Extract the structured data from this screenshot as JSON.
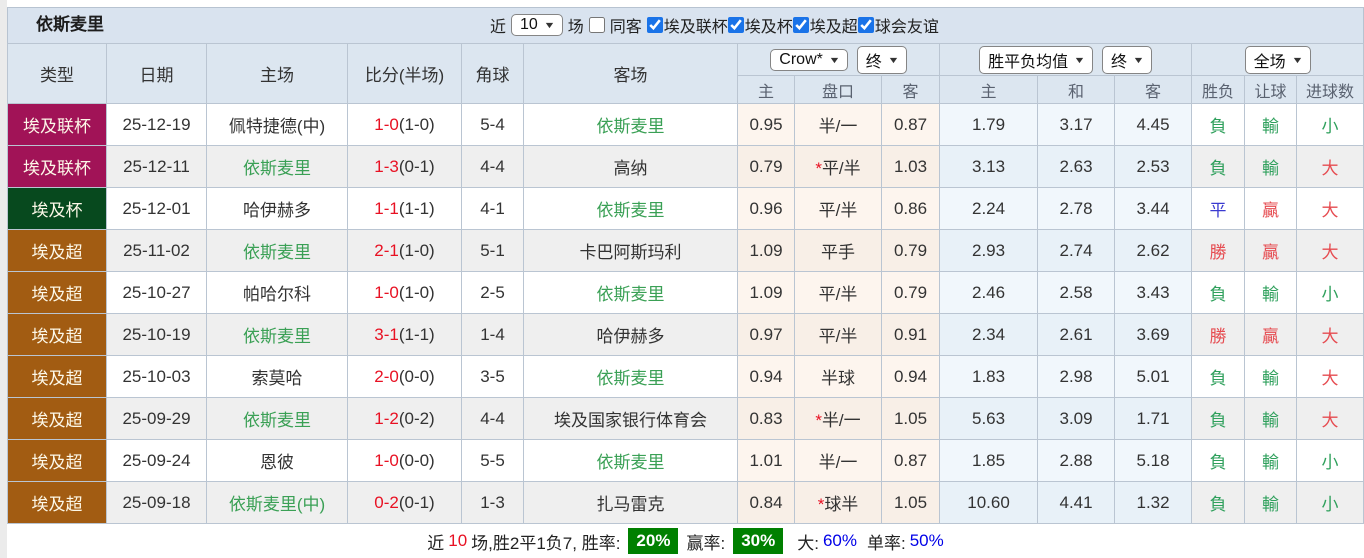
{
  "colors": {
    "league": {
      "埃及联杯": "#a11357",
      "埃及杯": "#07491e",
      "埃及超": "#a25c12"
    },
    "outcome": {
      "g": "#2fa05c",
      "r": "#e64c51",
      "b": "#3a3ad0"
    },
    "team_green": "#3aa055",
    "score_red": "#e81123",
    "badge_green": "#008000",
    "rate_blue": "#0000e8"
  },
  "page": {
    "team_title": "依斯麦里",
    "filter": {
      "near_label": "近",
      "near_value": "10",
      "matches_label": "场",
      "same_venue_label": "同客",
      "same_venue_checked": false,
      "competitions": [
        {
          "label": "埃及联杯",
          "checked": true
        },
        {
          "label": "埃及杯",
          "checked": true
        },
        {
          "label": "埃及超",
          "checked": true
        },
        {
          "label": "球会友谊",
          "checked": true
        }
      ]
    }
  },
  "table": {
    "headers": {
      "type": "类型",
      "date": "日期",
      "home": "主场",
      "score": "比分(半场)",
      "corner": "角球",
      "away": "客场",
      "odds_source_select": "Crow*",
      "odds_time_select": "终",
      "avg_select": "胜平负均值",
      "avg_time_select": "终",
      "result_select": "全场",
      "odds_sub": [
        "主",
        "盘口",
        "客"
      ],
      "avg_sub": [
        "主",
        "和",
        "客"
      ],
      "result_sub": [
        "胜负",
        "让球",
        "进球数"
      ]
    },
    "rows": [
      {
        "type": "埃及联杯",
        "date": "25-12-19",
        "home": {
          "text": "佩特捷德(中)",
          "green": false
        },
        "score_ft": "1-0",
        "score_ht": "(1-0)",
        "corner": "5-4",
        "away": {
          "text": "依斯麦里",
          "green": true
        },
        "odds": {
          "home": "0.95",
          "star": false,
          "line": "半/一",
          "away": "0.87"
        },
        "avg": {
          "home": "1.79",
          "draw": "3.17",
          "away": "4.45"
        },
        "outcome": [
          {
            "text": "負",
            "c": "g"
          },
          {
            "text": "輸",
            "c": "g"
          },
          {
            "text": "小",
            "c": "g"
          }
        ]
      },
      {
        "type": "埃及联杯",
        "date": "25-12-11",
        "home": {
          "text": "依斯麦里",
          "green": true
        },
        "score_ft": "1-3",
        "score_ht": "(0-1)",
        "corner": "4-4",
        "away": {
          "text": "高纳",
          "green": false
        },
        "odds": {
          "home": "0.79",
          "star": true,
          "line": "平/半",
          "away": "1.03"
        },
        "avg": {
          "home": "3.13",
          "draw": "2.63",
          "away": "2.53"
        },
        "outcome": [
          {
            "text": "負",
            "c": "g"
          },
          {
            "text": "輸",
            "c": "g"
          },
          {
            "text": "大",
            "c": "r"
          }
        ]
      },
      {
        "type": "埃及杯",
        "date": "25-12-01",
        "home": {
          "text": "哈伊赫多",
          "green": false
        },
        "score_ft": "1-1",
        "score_ht": "(1-1)",
        "corner": "4-1",
        "away": {
          "text": "依斯麦里",
          "green": true
        },
        "odds": {
          "home": "0.96",
          "star": false,
          "line": "平/半",
          "away": "0.86"
        },
        "avg": {
          "home": "2.24",
          "draw": "2.78",
          "away": "3.44"
        },
        "outcome": [
          {
            "text": "平",
            "c": "b"
          },
          {
            "text": "贏",
            "c": "r"
          },
          {
            "text": "大",
            "c": "r"
          }
        ]
      },
      {
        "type": "埃及超",
        "date": "25-11-02",
        "home": {
          "text": "依斯麦里",
          "green": true
        },
        "score_ft": "2-1",
        "score_ht": "(1-0)",
        "corner": "5-1",
        "away": {
          "text": "卡巴阿斯玛利",
          "green": false
        },
        "odds": {
          "home": "1.09",
          "star": false,
          "line": "平手",
          "away": "0.79"
        },
        "avg": {
          "home": "2.93",
          "draw": "2.74",
          "away": "2.62"
        },
        "outcome": [
          {
            "text": "勝",
            "c": "r"
          },
          {
            "text": "贏",
            "c": "r"
          },
          {
            "text": "大",
            "c": "r"
          }
        ]
      },
      {
        "type": "埃及超",
        "date": "25-10-27",
        "home": {
          "text": "帕哈尔科",
          "green": false
        },
        "score_ft": "1-0",
        "score_ht": "(1-0)",
        "corner": "2-5",
        "away": {
          "text": "依斯麦里",
          "green": true
        },
        "odds": {
          "home": "1.09",
          "star": false,
          "line": "平/半",
          "away": "0.79"
        },
        "avg": {
          "home": "2.46",
          "draw": "2.58",
          "away": "3.43"
        },
        "outcome": [
          {
            "text": "負",
            "c": "g"
          },
          {
            "text": "輸",
            "c": "g"
          },
          {
            "text": "小",
            "c": "g"
          }
        ]
      },
      {
        "type": "埃及超",
        "date": "25-10-19",
        "home": {
          "text": "依斯麦里",
          "green": true
        },
        "score_ft": "3-1",
        "score_ht": "(1-1)",
        "corner": "1-4",
        "away": {
          "text": "哈伊赫多",
          "green": false
        },
        "odds": {
          "home": "0.97",
          "star": false,
          "line": "平/半",
          "away": "0.91"
        },
        "avg": {
          "home": "2.34",
          "draw": "2.61",
          "away": "3.69"
        },
        "outcome": [
          {
            "text": "勝",
            "c": "r"
          },
          {
            "text": "贏",
            "c": "r"
          },
          {
            "text": "大",
            "c": "r"
          }
        ]
      },
      {
        "type": "埃及超",
        "date": "25-10-03",
        "home": {
          "text": "索莫哈",
          "green": false
        },
        "score_ft": "2-0",
        "score_ht": "(0-0)",
        "corner": "3-5",
        "away": {
          "text": "依斯麦里",
          "green": true
        },
        "odds": {
          "home": "0.94",
          "star": false,
          "line": "半球",
          "away": "0.94"
        },
        "avg": {
          "home": "1.83",
          "draw": "2.98",
          "away": "5.01"
        },
        "outcome": [
          {
            "text": "負",
            "c": "g"
          },
          {
            "text": "輸",
            "c": "g"
          },
          {
            "text": "大",
            "c": "r"
          }
        ]
      },
      {
        "type": "埃及超",
        "date": "25-09-29",
        "home": {
          "text": "依斯麦里",
          "green": true
        },
        "score_ft": "1-2",
        "score_ht": "(0-2)",
        "corner": "4-4",
        "away": {
          "text": "埃及国家银行体育会",
          "green": false
        },
        "odds": {
          "home": "0.83",
          "star": true,
          "line": "半/一",
          "away": "1.05"
        },
        "avg": {
          "home": "5.63",
          "draw": "3.09",
          "away": "1.71"
        },
        "outcome": [
          {
            "text": "負",
            "c": "g"
          },
          {
            "text": "輸",
            "c": "g"
          },
          {
            "text": "大",
            "c": "r"
          }
        ]
      },
      {
        "type": "埃及超",
        "date": "25-09-24",
        "home": {
          "text": "恩彼",
          "green": false
        },
        "score_ft": "1-0",
        "score_ht": "(0-0)",
        "corner": "5-5",
        "away": {
          "text": "依斯麦里",
          "green": true
        },
        "odds": {
          "home": "1.01",
          "star": false,
          "line": "半/一",
          "away": "0.87"
        },
        "avg": {
          "home": "1.85",
          "draw": "2.88",
          "away": "5.18"
        },
        "outcome": [
          {
            "text": "負",
            "c": "g"
          },
          {
            "text": "輸",
            "c": "g"
          },
          {
            "text": "小",
            "c": "g"
          }
        ]
      },
      {
        "type": "埃及超",
        "date": "25-09-18",
        "home": {
          "text": "依斯麦里(中)",
          "green": true
        },
        "score_ft": "0-2",
        "score_ht": "(0-1)",
        "corner": "1-3",
        "away": {
          "text": "扎马雷克",
          "green": false
        },
        "odds": {
          "home": "0.84",
          "star": true,
          "line": "球半",
          "away": "1.05"
        },
        "avg": {
          "home": "10.60",
          "draw": "4.41",
          "away": "1.32"
        },
        "outcome": [
          {
            "text": "負",
            "c": "g"
          },
          {
            "text": "輸",
            "c": "g"
          },
          {
            "text": "小",
            "c": "g"
          }
        ]
      }
    ]
  },
  "summary": {
    "near_label": "近",
    "near_count": "10",
    "stats_text": "场,胜2平1负7, 胜率:",
    "win_rate": "20%",
    "profit_label": "赢率:",
    "profit_rate": "30%",
    "big_label": "大:",
    "big_rate": "60%",
    "single_label": "单率:",
    "single_rate": "50%"
  }
}
